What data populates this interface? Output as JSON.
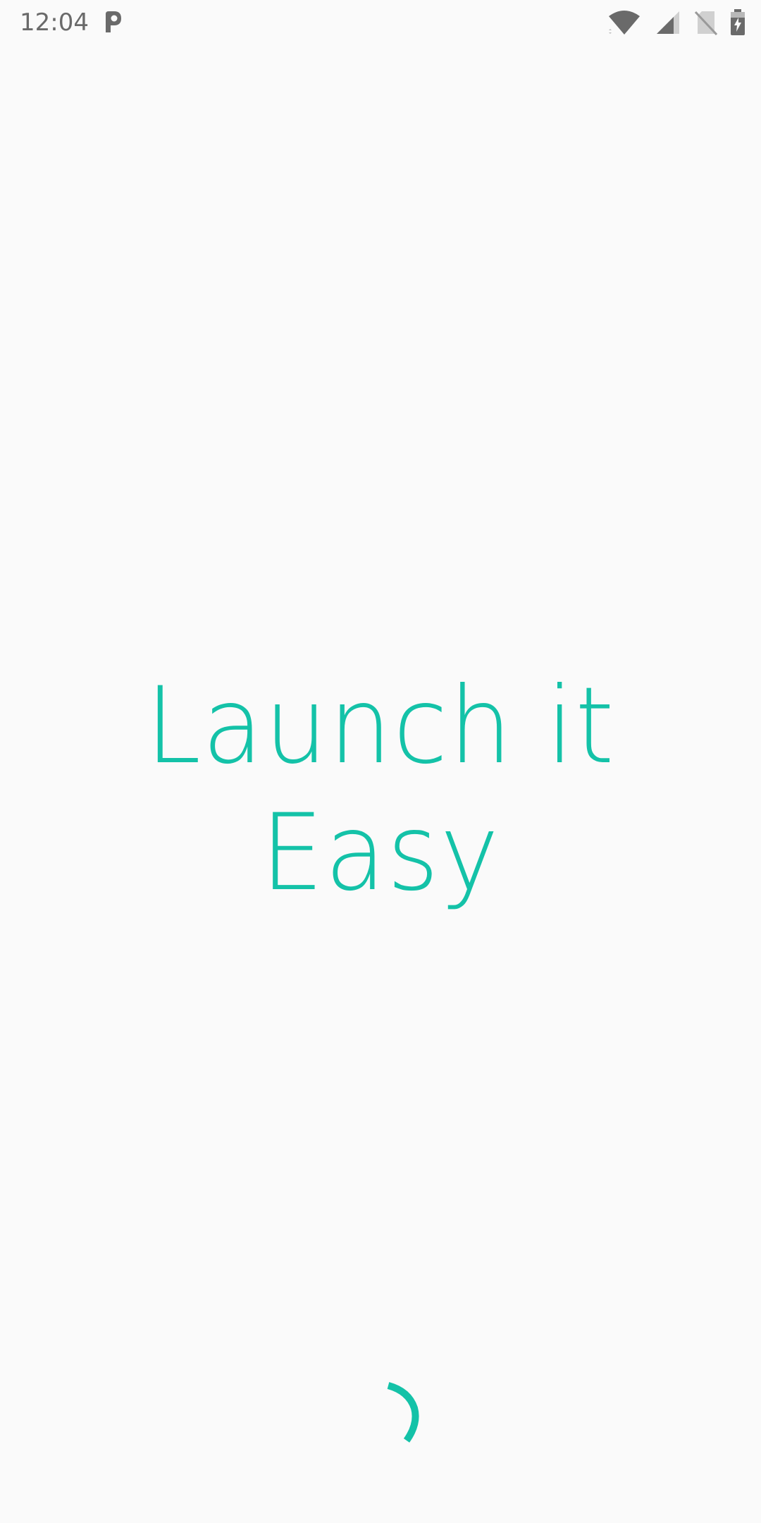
{
  "status_bar": {
    "time": "12:04",
    "notification_icon": "parking-p-icon",
    "icons": [
      "wifi-icon",
      "cell-signal-icon",
      "no-sim-icon",
      "battery-charging-icon"
    ]
  },
  "splash": {
    "title": "Launch it Easy",
    "loading_indicator": "progress-spinner-icon"
  },
  "colors": {
    "accent": "#14c2a8",
    "background": "#fafafa",
    "status_icon": "#6a6a6a"
  }
}
